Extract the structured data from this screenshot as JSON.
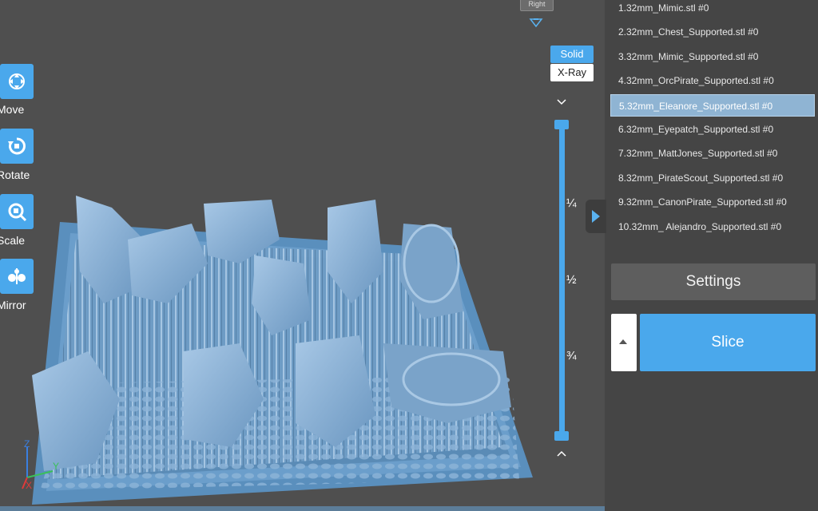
{
  "tools": [
    {
      "id": "move",
      "label": "Move",
      "icon": "move-icon"
    },
    {
      "id": "rotate",
      "label": "Rotate",
      "icon": "rotate-icon"
    },
    {
      "id": "scale",
      "label": "Scale",
      "icon": "scale-icon"
    },
    {
      "id": "mirror",
      "label": "Mirror",
      "icon": "mirror-icon"
    }
  ],
  "view": {
    "tab_label": "Right",
    "solid_label": "Solid",
    "xray_label": "X-Ray",
    "mode": "Solid"
  },
  "slider": {
    "marks": [
      "¼",
      "½",
      "¾"
    ]
  },
  "axis": {
    "z": "Z",
    "y": "Y",
    "x": "X"
  },
  "files": [
    {
      "label": "1.32mm_Mimic.stl #0"
    },
    {
      "label": "2.32mm_Chest_Supported.stl #0"
    },
    {
      "label": "3.32mm_Mimic_Supported.stl #0"
    },
    {
      "label": "4.32mm_OrcPirate_Supported.stl #0"
    },
    {
      "label": "5.32mm_Eleanore_Supported.stl #0",
      "selected": true
    },
    {
      "label": "6.32mm_Eyepatch_Supported.stl #0"
    },
    {
      "label": "7.32mm_MattJones_Supported.stl #0"
    },
    {
      "label": "8.32mm_PirateScout_Supported.stl #0"
    },
    {
      "label": "9.32mm_CanonPirate_Supported.stl #0"
    },
    {
      "label": "10.32mm_ Alejandro_Supported.stl #0"
    }
  ],
  "settings_label": "Settings",
  "slice_label": "Slice",
  "colors": {
    "accent": "#4aa8ec",
    "model": "#7ba6cc",
    "plate": "#5b8db8",
    "background": "#4f4f4f",
    "panel": "#454545"
  }
}
